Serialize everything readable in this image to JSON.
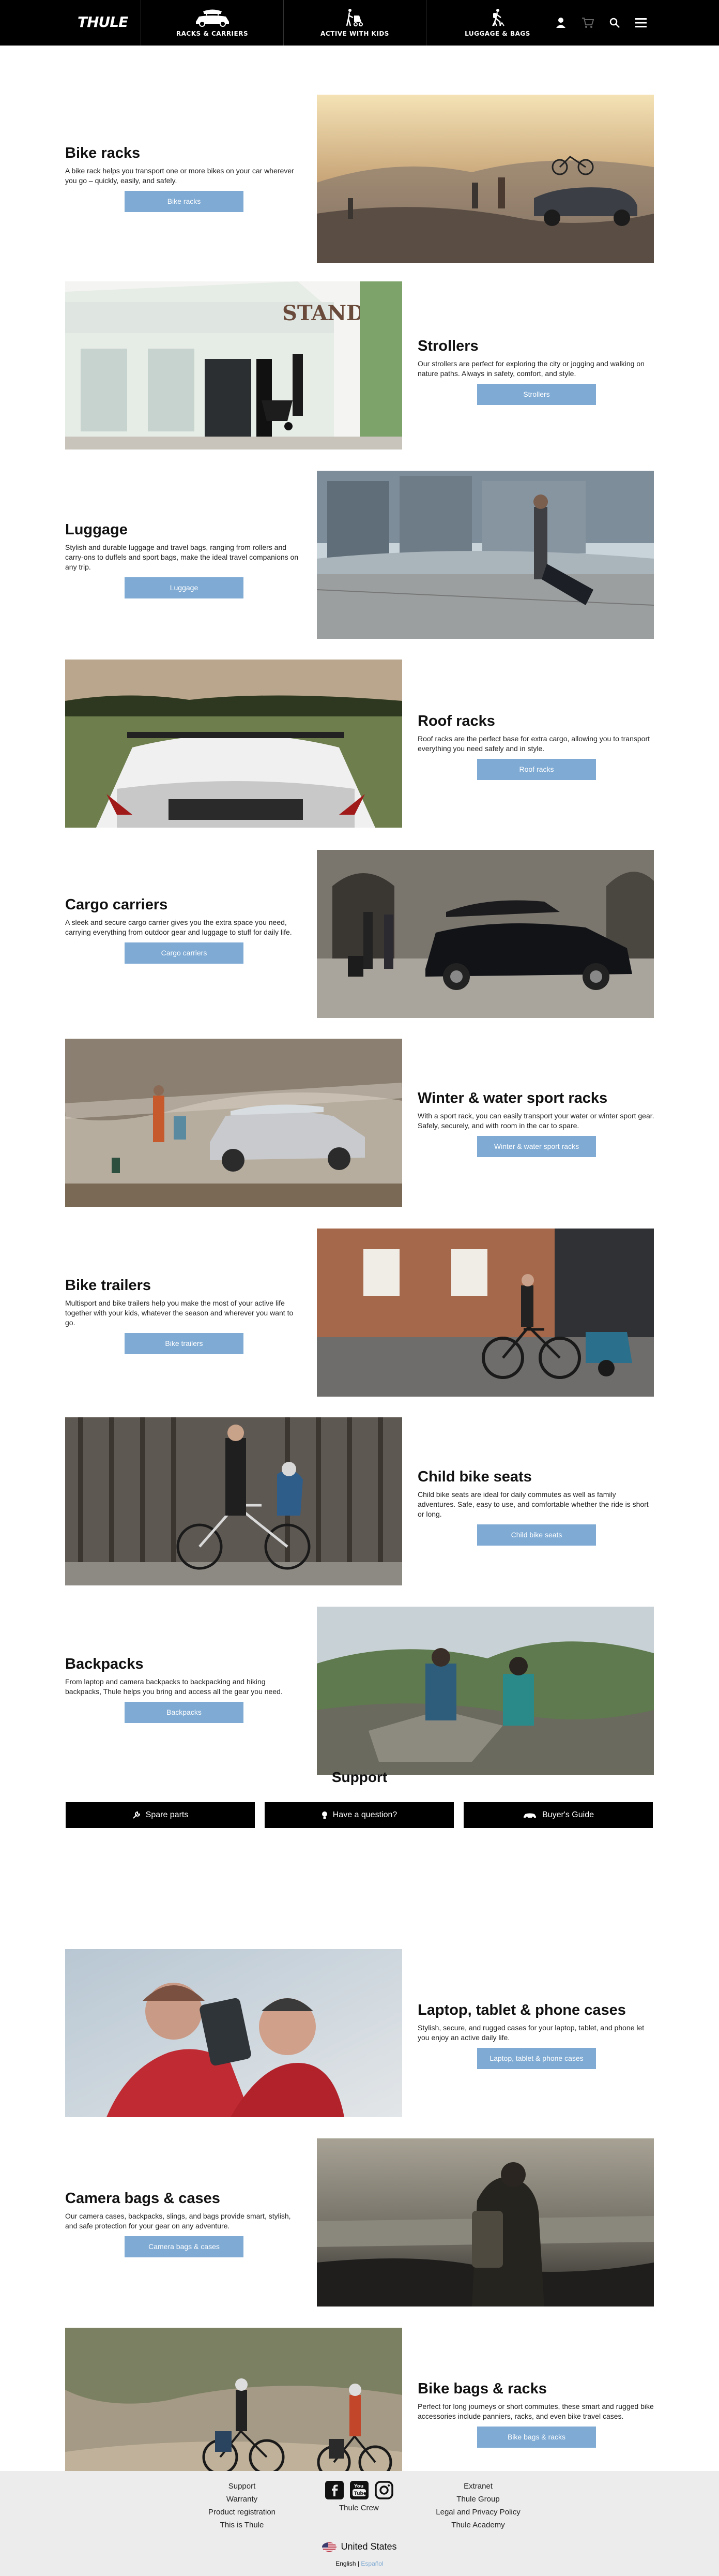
{
  "nav": {
    "logo": "THULE",
    "items": [
      {
        "label": "RACKS & CARRIERS",
        "icon": "car-roof-box-icon"
      },
      {
        "label": "ACTIVE WITH KIDS",
        "icon": "stroller-icon"
      },
      {
        "label": "LUGGAGE & BAGS",
        "icon": "backpack-hiker-icon"
      }
    ],
    "tools": [
      "account-icon",
      "cart-icon",
      "search-icon",
      "menu-icon"
    ]
  },
  "categories": [
    {
      "title": "Bike racks",
      "text": "A bike rack helps you transport one or more bikes on your car wherever you go – quickly, easily, and safely.",
      "button": "Bike racks"
    },
    {
      "title": "Strollers",
      "text": "Our strollers are perfect for exploring the city or jogging and walking on nature paths. Always in safety, comfort, and style.",
      "button": "Strollers"
    },
    {
      "title": "Luggage",
      "text": "Stylish and durable luggage and travel bags, ranging from rollers and carry-ons to duffels and sport bags, make the ideal travel companions on any trip.",
      "button": "Luggage"
    },
    {
      "title": "Roof racks",
      "text": "Roof racks are the perfect base for extra cargo, allowing you to transport everything you need safely and in style.",
      "button": "Roof racks"
    },
    {
      "title": "Cargo carriers",
      "text": "A sleek and secure cargo carrier gives you the extra space you need, carrying everything from outdoor gear and luggage to stuff for daily life.",
      "button": "Cargo carriers"
    },
    {
      "title": "Winter & water sport racks",
      "text": "With a sport rack, you can easily transport your water or winter sport gear. Safely, securely, and with room in the car to spare.",
      "button": "Winter & water sport racks"
    },
    {
      "title": "Bike trailers",
      "text": "Multisport and bike trailers help you make the most of your active life together with your kids, whatever the season and wherever you want to go.",
      "button": "Bike trailers"
    },
    {
      "title": "Child bike seats",
      "text": "Child bike seats are ideal for daily commutes as well as family adventures. Safe, easy to use, and comfortable whether the ride is short or long.",
      "button": "Child bike seats"
    },
    {
      "title": "Backpacks",
      "text": "From laptop and camera backpacks to backpacking and hiking backpacks, Thule helps you bring and access all the gear you need.",
      "button": "Backpacks"
    },
    {
      "title": "Laptop, tablet & phone cases",
      "text": "Stylish, secure, and rugged cases for your laptop, tablet, and phone let you enjoy an active daily life.",
      "button": "Laptop, tablet & phone cases"
    },
    {
      "title": "Camera bags & cases",
      "text": "Our camera cases, backpacks, slings, and bags provide smart, stylish, and safe protection for your gear on any adventure.",
      "button": "Camera bags & cases"
    },
    {
      "title": "Bike bags & racks",
      "text": "Perfect for long journeys or short commutes, these smart and rugged bike accessories include panniers, racks, and even bike travel cases.",
      "button": "Bike bags & racks"
    }
  ],
  "support": {
    "title": "Support",
    "buttons": [
      {
        "label": "Spare parts",
        "icon": "wrench-icon"
      },
      {
        "label": "Have a question?",
        "icon": "lightbulb-icon"
      },
      {
        "label": "Buyer's Guide",
        "icon": "car-icon"
      }
    ]
  },
  "footer": {
    "col1": [
      "Support",
      "Warranty",
      "Product registration",
      "This is Thule"
    ],
    "social": [
      "facebook-icon",
      "youtube-icon",
      "instagram-icon"
    ],
    "crew": "Thule Crew",
    "col3": [
      "Extranet",
      "Thule Group",
      "Legal and Privacy Policy",
      "Thule Academy"
    ],
    "country": "United States",
    "lang_en": "English",
    "lang_sep": "|",
    "lang_es": "Español"
  },
  "colors": {
    "button": "#7eaad4",
    "nav": "#000000",
    "footer": "#ececec"
  }
}
